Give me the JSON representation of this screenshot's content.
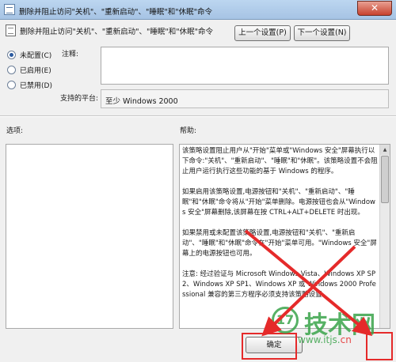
{
  "window": {
    "title": "删除并阻止访问\"关机\"、\"重新启动\"、\"睡眠\"和\"休眠\"命令",
    "close_label": "✕"
  },
  "policy": {
    "name": "删除并阻止访问\"关机\"、\"重新启动\"、\"睡眠\"和\"休眠\"命令"
  },
  "nav": {
    "prev_label": "上一个设置(P)",
    "next_label": "下一个设置(N)"
  },
  "state": {
    "options": [
      {
        "label": "未配置(C)",
        "checked": true
      },
      {
        "label": "已启用(E)",
        "checked": false
      },
      {
        "label": "已禁用(D)",
        "checked": false
      }
    ]
  },
  "comment": {
    "label": "注释:",
    "value": ""
  },
  "platform": {
    "label": "支持的平台:",
    "value": "至少 Windows 2000"
  },
  "options_section": {
    "label": "选项:"
  },
  "help_section": {
    "label": "帮助:",
    "paragraphs": [
      "该策略设置阻止用户从\"开始\"菜单或\"Windows 安全\"屏幕执行以下命令:\"关机\"、\"重新启动\"、\"睡眠\"和\"休眠\"。该策略设置不会阻止用户运行执行这些功能的基于 Windows 的程序。",
      "如果启用该策略设置,电源按钮和\"关机\"、\"重新启动\"、\"睡眠\"和\"休眠\"命令将从\"开始\"菜单删除。电源按钮也会从\"Windows 安全\"屏幕删除,该屏幕在按 CTRL+ALT+DELETE 时出现。",
      "如果禁用或未配置该策略设置,电源按钮和\"关机\"、\"重新启动\"、\"睡眠\"和\"休眠\"命令在\"开始\"菜单可用。\"Windows 安全\"屏幕上的电源按钮也可用。",
      "注意: 经过验证与 Microsoft Windows Vista、Windows XP SP2、Windows XP SP1、Windows XP 或 Windows 2000 Professional 兼容的第三方程序必须支持该策略设置。"
    ]
  },
  "buttons": {
    "ok_label": "确定"
  },
  "watermark": {
    "text": "技术网",
    "url_prefix": "www.itjs.",
    "url_suffix": "cn",
    "logo_glyph": "17"
  },
  "colors": {
    "annotation": "#e52a2a",
    "watermark": "#3aa44b"
  }
}
